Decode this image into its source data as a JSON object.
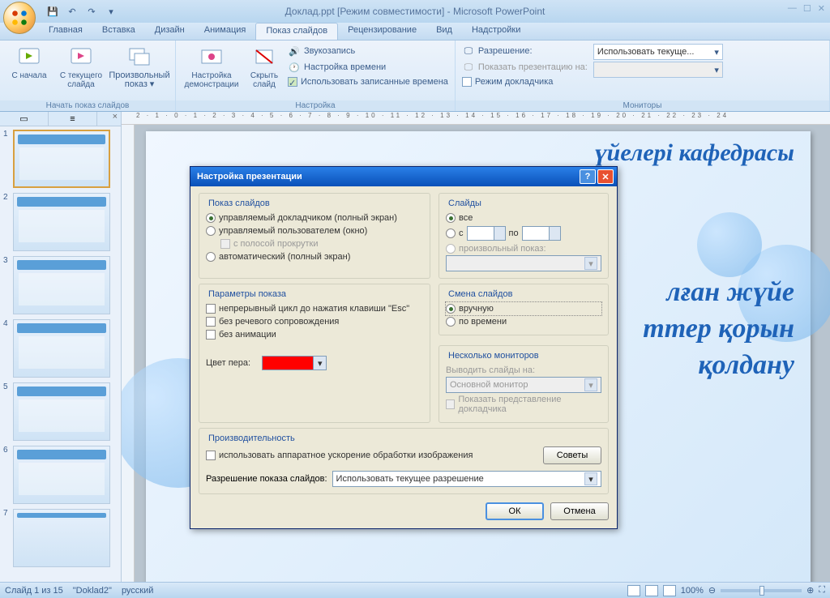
{
  "title": "Доклад.ppt [Режим совместимости] - Microsoft PowerPoint",
  "tabs": [
    "Главная",
    "Вставка",
    "Дизайн",
    "Анимация",
    "Показ слайдов",
    "Рецензирование",
    "Вид",
    "Надстройки"
  ],
  "active_tab": 4,
  "ribbon": {
    "group1": {
      "label": "Начать показ слайдов",
      "btn1": "С начала",
      "btn2": "С текущего слайда",
      "btn3": "Произвольный показ"
    },
    "group2": {
      "label": "Настройка",
      "btn1": "Настройка демонстрации",
      "btn2": "Скрыть слайд",
      "item1": "Звукозапись",
      "item2": "Настройка времени",
      "item3": "Использовать записанные времена"
    },
    "group3": {
      "label": "Мониторы",
      "item1": "Разрешение:",
      "item2": "Показать презентацию на:",
      "item3": "Режим докладчика",
      "combo1": "Использовать текуще..."
    }
  },
  "dialog": {
    "title": "Настройка презентации",
    "fs1": {
      "legend": "Показ слайдов",
      "r1": "управляемый докладчиком (полный экран)",
      "r2": "управляемый пользователем (окно)",
      "c1": "с полосой прокрутки",
      "r3": "автоматический (полный экран)"
    },
    "fs2": {
      "legend": "Слайды",
      "r1": "все",
      "r2_from": "с",
      "r2_to": "по",
      "r3": "произвольный показ:"
    },
    "fs3": {
      "legend": "Параметры показа",
      "c1": "непрерывный цикл до нажатия клавиши \"Esc\"",
      "c2": "без речевого сопровождения",
      "c3": "без анимации",
      "penlabel": "Цвет пера:"
    },
    "fs4": {
      "legend": "Смена слайдов",
      "r1": "вручную",
      "r2": "по времени"
    },
    "fs5": {
      "legend": "Несколько мониторов",
      "lbl1": "Выводить слайды на:",
      "combo1": "Основной монитор",
      "c1": "Показать представление докладчика"
    },
    "fs6": {
      "legend": "Производительность",
      "c1": "использовать аппаратное ускорение обработки изображения",
      "btn_tips": "Советы",
      "lbl2": "Разрешение показа слайдов:",
      "combo2": "Использовать текущее разрешение"
    },
    "ok": "ОК",
    "cancel": "Отмена"
  },
  "slide": {
    "text1": "үйелері кафедрасы",
    "text2": "лған жүйе",
    "text3": "ттер қорын",
    "text4": "қолдану"
  },
  "status": {
    "slide": "Слайд 1 из 15",
    "theme": "\"Doklad2\"",
    "lang": "русский",
    "zoom": "100%"
  },
  "ruler": "2 · 1 · 0 · 1 · 2 · 3 · 4 · 5 · 6 · 7 · 8 · 9 · 10 · 11 · 12 · 13 · 14 · 15 · 16 · 17 · 18 · 19 · 20 · 21 · 22 · 23 · 24"
}
